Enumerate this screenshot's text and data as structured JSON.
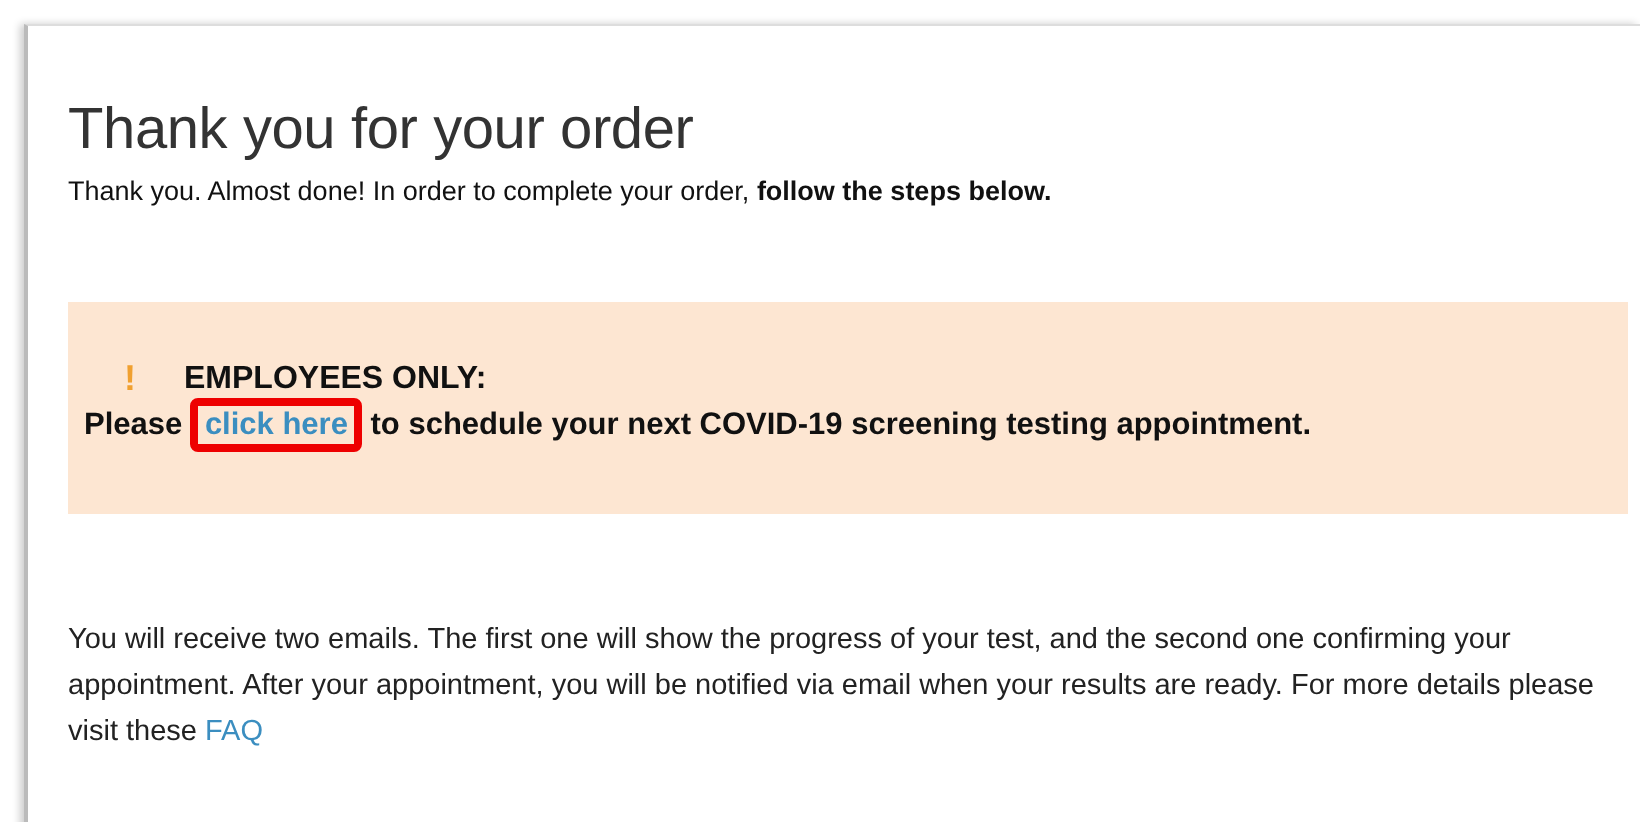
{
  "title": "Thank you for your order",
  "intro": "Thank you. Almost done! In order to complete your order, **follow the steps below.**",
  "notice": {
    "icon": "!",
    "heading": "EMPLOYEES ONLY:",
    "before": "Please ",
    "link": {
      "text": "click here",
      "highlighted": true
    },
    "after": " to schedule your next COVID-19 screening testing appointment."
  },
  "info": {
    "text": "You will receive two emails. The first one will show the progress of your test, and the second one confirming your appointment. After your appointment, you will be notified via email when your results are ready. For more details please visit these ",
    "link": "FAQ"
  }
}
